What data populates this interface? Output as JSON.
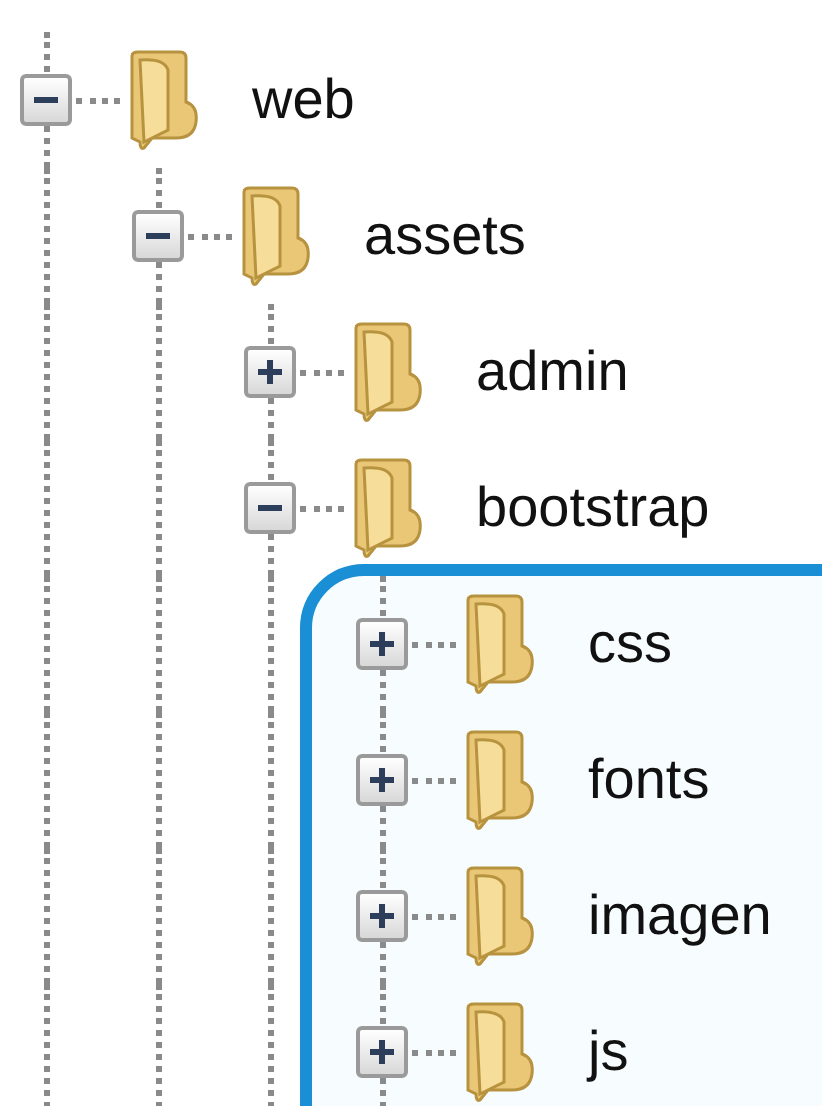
{
  "tree": [
    {
      "label": "web",
      "expanded": true,
      "children": [
        {
          "label": "assets",
          "expanded": true,
          "children": [
            {
              "label": "admin",
              "expanded": false
            },
            {
              "label": "bootstrap",
              "expanded": true,
              "children_highlighted": true,
              "children": [
                {
                  "label": "css",
                  "expanded": false
                },
                {
                  "label": "fonts",
                  "expanded": false
                },
                {
                  "label": "imagen",
                  "expanded": false
                },
                {
                  "label": "js",
                  "expanded": false
                }
              ]
            }
          ]
        }
      ]
    }
  ]
}
